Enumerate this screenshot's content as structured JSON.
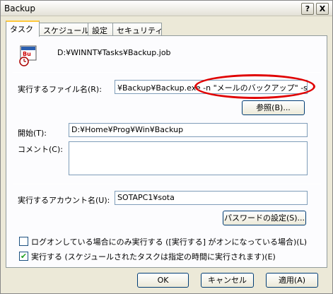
{
  "window": {
    "title": "Backup",
    "help_label": "?",
    "close_label": "X"
  },
  "tabs": [
    {
      "label": "タスク"
    },
    {
      "label": "スケジュール"
    },
    {
      "label": "設定"
    },
    {
      "label": "セキュリティ"
    }
  ],
  "task": {
    "job_path": "D:¥WINNT¥Tasks¥Backup.job",
    "run_label": "実行するファイル名(R):",
    "run_value": "¥Backup¥Backup.exe -n \"メールのバックアップ\" -s -c",
    "browse_label": "参照(B)...",
    "startin_label": "開始(T):",
    "startin_value": "D:¥Home¥Prog¥Win¥Backup",
    "comment_label": "コメント(C):",
    "comment_value": "",
    "runas_label": "実行するアカウント名(U):",
    "runas_value": "SOTAPC1¥sota",
    "password_label": "パスワードの設定(S)...",
    "logon_only_label": "ログオンしている場合にのみ実行する ([実行する] がオンになっている場合)(L)",
    "logon_only_checked": false,
    "enabled_label": "実行する (スケジュールされたタスクは指定の時間に実行されます)(E)",
    "enabled_checked": true
  },
  "buttons": {
    "ok": "OK",
    "cancel": "キャンセル",
    "apply": "適用(A)"
  },
  "colors": {
    "highlight_ellipse": "#e00000",
    "tab_accent": "#ffc83c"
  },
  "icons": {
    "job": "scheduled-task-icon",
    "check": "✔"
  }
}
